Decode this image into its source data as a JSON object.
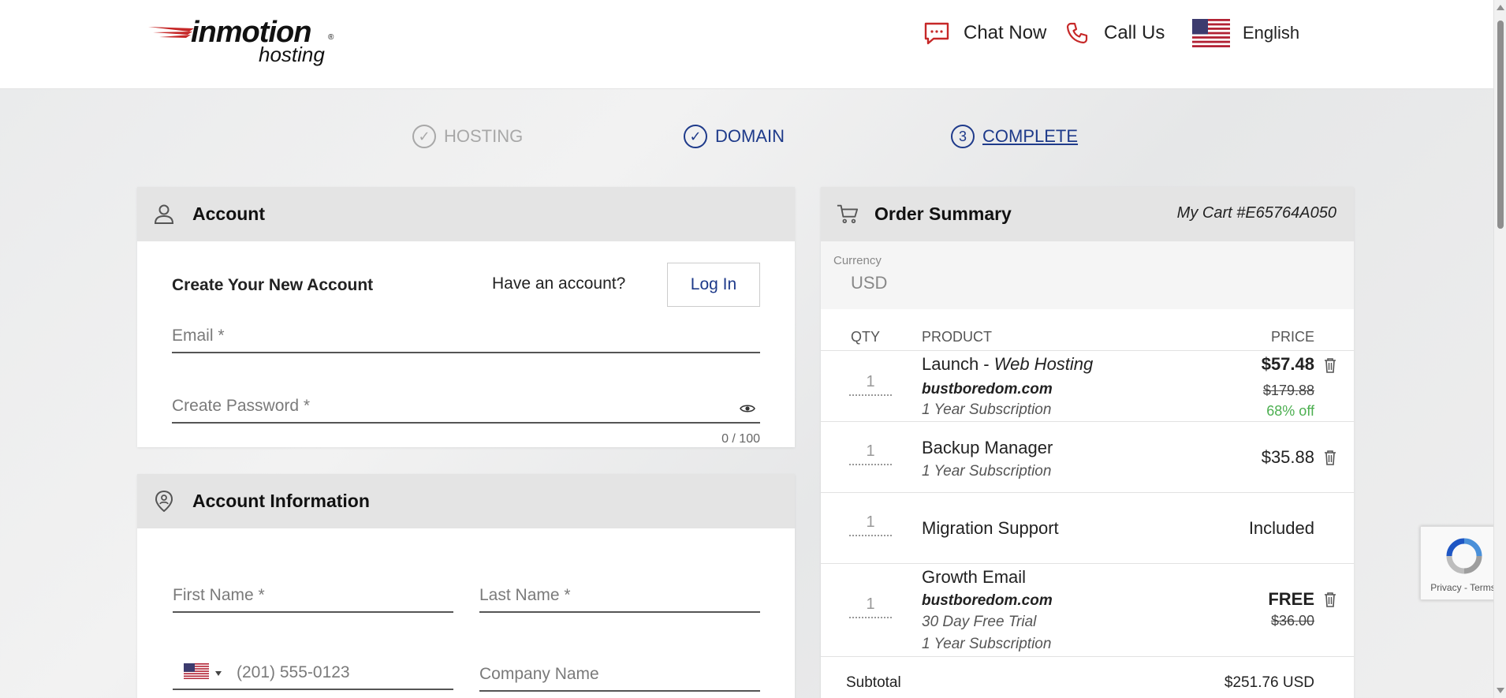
{
  "header": {
    "logo": {
      "word1": "inmotion",
      "word2": "hosting",
      "reg": "®"
    },
    "chat_label": "Chat Now",
    "call_label": "Call Us",
    "language_label": "English"
  },
  "steps": [
    {
      "label": "HOSTING",
      "state": "done"
    },
    {
      "label": "DOMAIN",
      "state": "done"
    },
    {
      "label": "COMPLETE",
      "number": "3",
      "state": "current"
    }
  ],
  "account": {
    "title": "Account",
    "create_title": "Create Your New Account",
    "have_account": "Have an account?",
    "login_label": "Log In",
    "email_placeholder": "Email *",
    "password_placeholder": "Create Password *",
    "password_counter": "0 / 100"
  },
  "account_info": {
    "title": "Account Information",
    "first_name_placeholder": "First Name *",
    "last_name_placeholder": "Last Name *",
    "phone_placeholder": "(201) 555-0123",
    "company_placeholder": "Company Name"
  },
  "order": {
    "title": "Order Summary",
    "cart_number": "My Cart #E65764A050",
    "currency_label": "Currency",
    "currency_value": "USD",
    "col_qty": "QTY",
    "col_product": "PRODUCT",
    "col_price": "PRICE",
    "items": [
      {
        "qty": "1",
        "name": "Launch - ",
        "name_em": "Web Hosting",
        "domain": "bustboredom.com",
        "sub": "1 Year Subscription",
        "price": "$57.48",
        "original": "$179.88",
        "discount": "68% off"
      },
      {
        "qty": "1",
        "name": "Backup Manager",
        "sub": "1 Year Subscription",
        "price": "$35.88"
      },
      {
        "qty": "1",
        "name": "Migration Support",
        "price": "Included"
      },
      {
        "qty": "1",
        "name": "Growth Email",
        "domain": "bustboredom.com",
        "sub": "30 Day Free Trial",
        "sub2": "1 Year Subscription",
        "price": "FREE",
        "original": "$36.00"
      }
    ],
    "subtotal_label": "Subtotal",
    "subtotal_value": "$251.76 USD"
  },
  "recaptcha": {
    "privacy": "Privacy",
    "sep": " - ",
    "terms": "Terms"
  },
  "colors": {
    "brand_blue": "#1e3a8a",
    "brand_red": "#c62828",
    "discount_green": "#4caf50"
  }
}
